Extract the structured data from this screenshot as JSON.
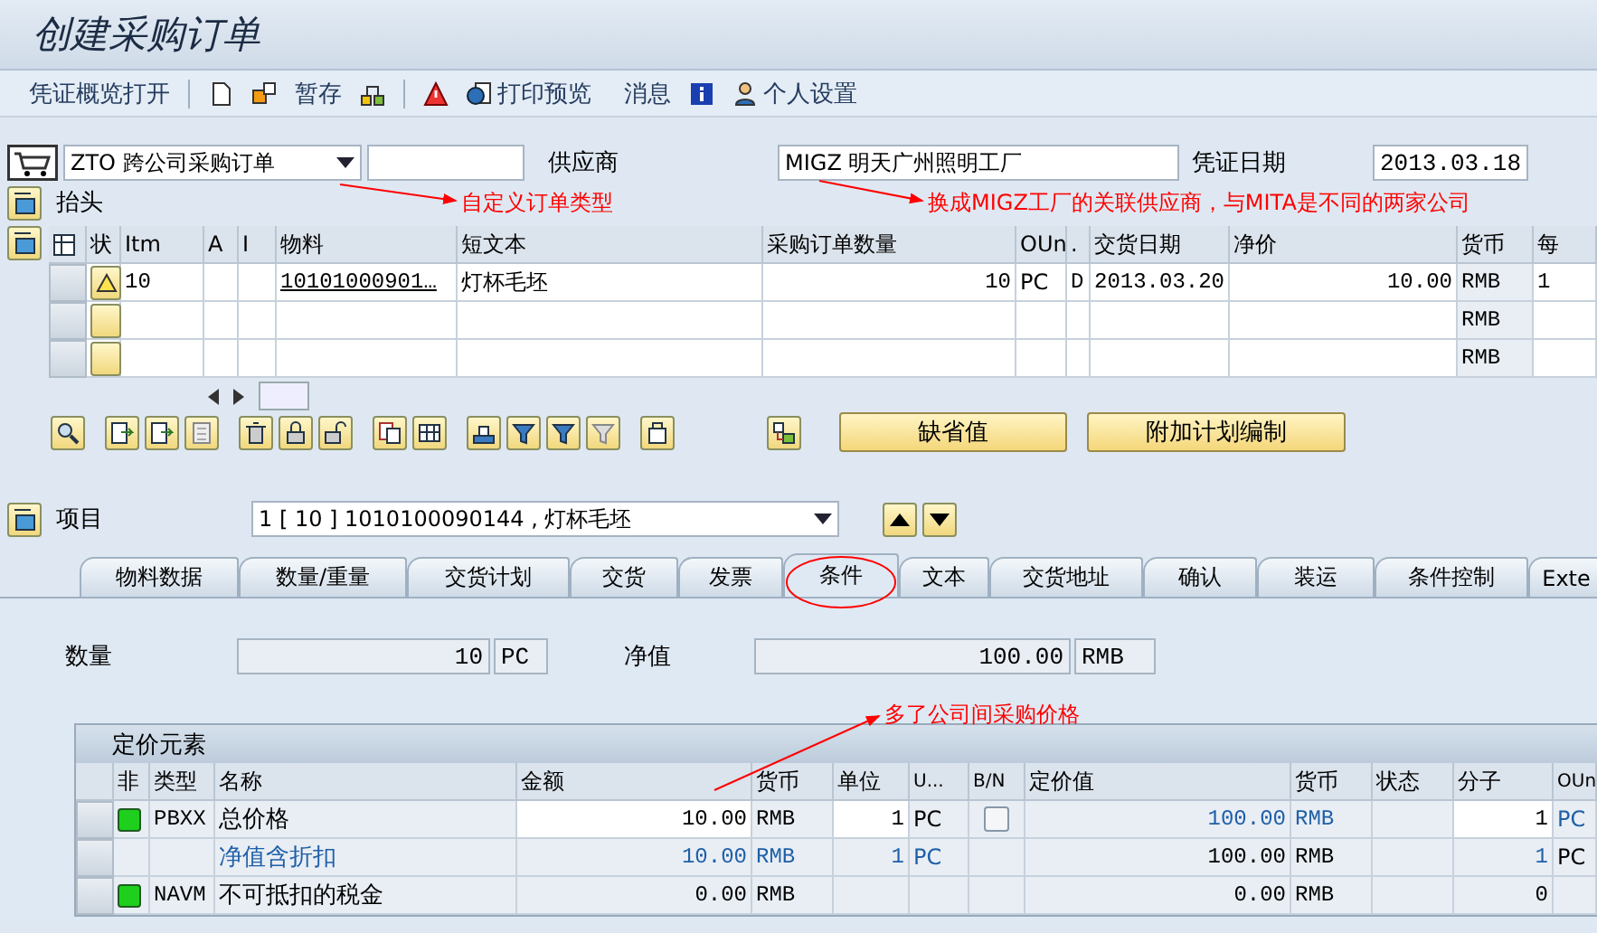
{
  "window": {
    "title": "创建采购订单"
  },
  "toolbar": {
    "buttons": [
      "凭证概览打开",
      "暂存",
      "打印预览",
      "消息",
      "个人设置"
    ]
  },
  "header": {
    "order_type": "ZTO 跨公司采购订单",
    "vendor_label": "供应商",
    "vendor": "MIGZ 明天广州照明工厂",
    "date_label": "凭证日期",
    "date": "2013.03.18",
    "section": "抬头"
  },
  "items_table": {
    "columns": [
      "状",
      "Itm",
      "A",
      "I",
      "物料",
      "短文本",
      "采购订单数量",
      "OUn",
      ".",
      "交货日期",
      "净价",
      "货币",
      "每"
    ],
    "rows": [
      {
        "warning": true,
        "item": "10",
        "material": "10101000901…",
        "short_text": "灯杯毛坯",
        "quantity": "10",
        "unit": "PC",
        "category": "D",
        "delivery_date": "2013.03.20",
        "net_price": "10.00",
        "currency": "RMB",
        "per": "1"
      },
      {
        "warning": false,
        "currency": "RMB"
      },
      {
        "warning": false,
        "currency": "RMB"
      }
    ]
  },
  "item_buttons": [
    "缺省值",
    "附加计划编制"
  ],
  "item_detail": {
    "label": "项目",
    "selected_item": "1 [ 10 ] 1010100090144 , 灯杯毛坯",
    "tabs": [
      {
        "label": "物料数据",
        "selected": false
      },
      {
        "label": "数量/重量",
        "selected": false
      },
      {
        "label": "交货计划",
        "selected": false
      },
      {
        "label": "交货",
        "selected": false
      },
      {
        "label": "发票",
        "selected": false
      },
      {
        "label": "条件",
        "selected": true
      },
      {
        "label": "文本",
        "selected": false
      },
      {
        "label": "交货地址",
        "selected": false
      },
      {
        "label": "确认",
        "selected": false
      },
      {
        "label": "装运",
        "selected": false
      },
      {
        "label": "条件控制",
        "selected": false
      },
      {
        "label": "Exte",
        "selected": false
      }
    ],
    "quantity_label": "数量",
    "quantity": "10",
    "quantity_unit": "PC",
    "net_value_label": "净值",
    "net_value": "100.00",
    "net_value_currency": "RMB",
    "pricing": {
      "title": "定价元素",
      "columns": [
        "非",
        "类型",
        "名称",
        "金额",
        "货币",
        "单位",
        "U...",
        "B/N",
        "定价值",
        "货币",
        "状态",
        "分子",
        "OUn"
      ],
      "rows": [
        {
          "kind": "price",
          "active": true,
          "type": "PBXX",
          "name": "总价格",
          "amount": "10.00",
          "currency": "RMB",
          "per": "1",
          "uom": "PC",
          "bn_checked": false,
          "value": "100.00",
          "value_currency": "RMB",
          "numerator": "1",
          "oun": "PC"
        },
        {
          "kind": "subtotal",
          "active": false,
          "name": "净值含折扣",
          "amount": "10.00",
          "currency": "RMB",
          "per": "1",
          "uom": "PC",
          "value": "100.00",
          "value_currency": "RMB",
          "numerator": "1",
          "oun": "PC"
        },
        {
          "kind": "tax",
          "active": true,
          "type": "NAVM",
          "name": "不可抵扣的税金",
          "amount": "0.00",
          "currency": "RMB",
          "value": "0.00",
          "value_currency": "RMB",
          "numerator": "0"
        }
      ]
    }
  },
  "annotations": [
    "自定义订单类型",
    "换成MIGZ工厂的关联供应商，与MITA是不同的两家公司",
    "多了公司间采购价格"
  ]
}
